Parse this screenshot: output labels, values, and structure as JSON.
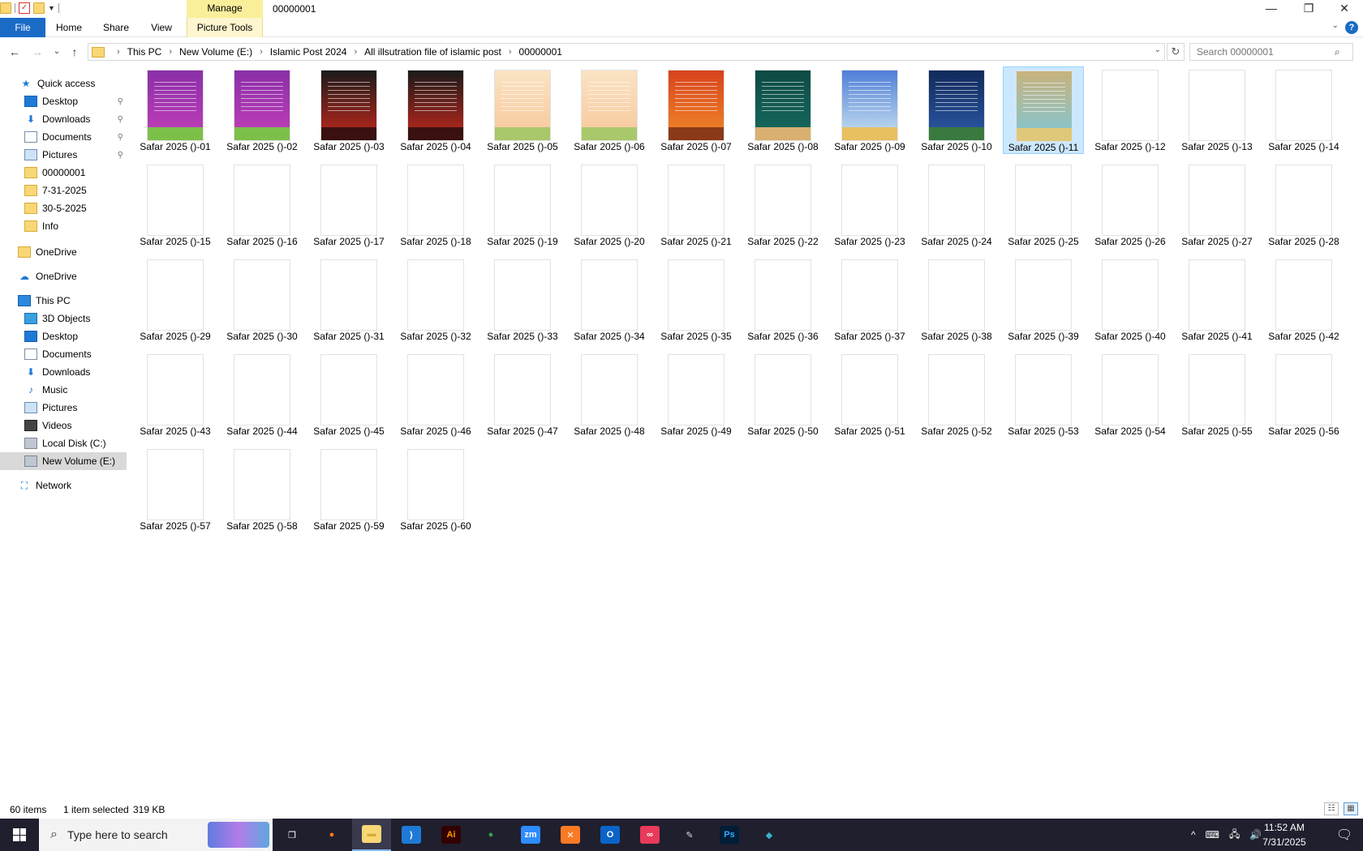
{
  "window": {
    "title": "00000001",
    "manage_label": "Manage",
    "minimize": "—",
    "restore": "❐",
    "close": "✕"
  },
  "ribbon": {
    "tabs": [
      "File",
      "Home",
      "Share",
      "View"
    ],
    "tools_tab": "Picture Tools",
    "collapse": "⌄",
    "help": "?"
  },
  "nav": {
    "back": "←",
    "forward": "→",
    "recent": "⌄",
    "up": "↑",
    "breadcrumbs": [
      "This PC",
      "New Volume (E:)",
      "Islamic Post 2024",
      "All illsutration file of islamic post",
      "00000001"
    ],
    "separator": "›",
    "dropdown": "⌄",
    "refresh": "↻",
    "search_placeholder": "Search 00000001",
    "search_icon": "⌕"
  },
  "sidebar": {
    "items": [
      {
        "label": "Quick access",
        "icon": "star-icon",
        "pinned": false
      },
      {
        "label": "Desktop",
        "icon": "desktop-icon",
        "pinned": true
      },
      {
        "label": "Downloads",
        "icon": "download-icon",
        "pinned": true
      },
      {
        "label": "Documents",
        "icon": "documents-icon",
        "pinned": true
      },
      {
        "label": "Pictures",
        "icon": "pictures-icon",
        "pinned": true
      },
      {
        "label": "00000001",
        "icon": "folder-icon",
        "pinned": false
      },
      {
        "label": "7-31-2025",
        "icon": "folder-icon",
        "pinned": false
      },
      {
        "label": "30-5-2025",
        "icon": "folder-icon",
        "pinned": false
      },
      {
        "label": "Info",
        "icon": "folder-icon",
        "pinned": false
      },
      {
        "label": "OneDrive",
        "icon": "folder-icon",
        "pinned": false
      },
      {
        "label": "OneDrive",
        "icon": "cloud-icon",
        "pinned": false
      },
      {
        "label": "This PC",
        "icon": "computer-icon",
        "pinned": false
      },
      {
        "label": "3D Objects",
        "icon": "3d-objects-icon",
        "pinned": false
      },
      {
        "label": "Desktop",
        "icon": "desktop-icon",
        "pinned": false
      },
      {
        "label": "Documents",
        "icon": "documents-icon",
        "pinned": false
      },
      {
        "label": "Downloads",
        "icon": "download-icon",
        "pinned": false
      },
      {
        "label": "Music",
        "icon": "music-icon",
        "pinned": false
      },
      {
        "label": "Pictures",
        "icon": "pictures-icon",
        "pinned": false
      },
      {
        "label": "Videos",
        "icon": "videos-icon",
        "pinned": false
      },
      {
        "label": "Local Disk (C:)",
        "icon": "disk-icon",
        "pinned": false
      },
      {
        "label": "New Volume (E:)",
        "icon": "drive-icon",
        "pinned": false,
        "selected": true
      },
      {
        "label": "Network",
        "icon": "network-icon",
        "pinned": false
      }
    ],
    "pin_glyph": "📌"
  },
  "files": {
    "selected_index": 10,
    "items": [
      {
        "name": "Safar 2025 ()-01",
        "thumb": "purple"
      },
      {
        "name": "Safar 2025 ()-02",
        "thumb": "purple"
      },
      {
        "name": "Safar 2025 ()-03",
        "thumb": "red-dark"
      },
      {
        "name": "Safar 2025 ()-04",
        "thumb": "red-dark"
      },
      {
        "name": "Safar 2025 ()-05",
        "thumb": "peach"
      },
      {
        "name": "Safar 2025 ()-06",
        "thumb": "peach"
      },
      {
        "name": "Safar 2025 ()-07",
        "thumb": "orange"
      },
      {
        "name": "Safar 2025 ()-08",
        "thumb": "teal"
      },
      {
        "name": "Safar 2025 ()-09",
        "thumb": "sky"
      },
      {
        "name": "Safar 2025 ()-10",
        "thumb": "navy"
      },
      {
        "name": "Safar 2025 ()-11",
        "thumb": "beach"
      },
      {
        "name": "Safar 2025 ()-12",
        "thumb": "blank"
      },
      {
        "name": "Safar 2025 ()-13",
        "thumb": "blank"
      },
      {
        "name": "Safar 2025 ()-14",
        "thumb": "blank"
      },
      {
        "name": "Safar 2025 ()-15",
        "thumb": "blank"
      },
      {
        "name": "Safar 2025 ()-16",
        "thumb": "blank"
      },
      {
        "name": "Safar 2025 ()-17",
        "thumb": "blank"
      },
      {
        "name": "Safar 2025 ()-18",
        "thumb": "blank"
      },
      {
        "name": "Safar 2025 ()-19",
        "thumb": "blank"
      },
      {
        "name": "Safar 2025 ()-20",
        "thumb": "blank"
      },
      {
        "name": "Safar 2025 ()-21",
        "thumb": "blank"
      },
      {
        "name": "Safar 2025 ()-22",
        "thumb": "blank"
      },
      {
        "name": "Safar 2025 ()-23",
        "thumb": "blank"
      },
      {
        "name": "Safar 2025 ()-24",
        "thumb": "blank"
      },
      {
        "name": "Safar 2025 ()-25",
        "thumb": "blank"
      },
      {
        "name": "Safar 2025 ()-26",
        "thumb": "blank"
      },
      {
        "name": "Safar 2025 ()-27",
        "thumb": "blank"
      },
      {
        "name": "Safar 2025 ()-28",
        "thumb": "blank"
      },
      {
        "name": "Safar 2025 ()-29",
        "thumb": "blank"
      },
      {
        "name": "Safar 2025 ()-30",
        "thumb": "blank"
      },
      {
        "name": "Safar 2025 ()-31",
        "thumb": "blank"
      },
      {
        "name": "Safar 2025 ()-32",
        "thumb": "blank"
      },
      {
        "name": "Safar 2025 ()-33",
        "thumb": "blank"
      },
      {
        "name": "Safar 2025 ()-34",
        "thumb": "blank"
      },
      {
        "name": "Safar 2025 ()-35",
        "thumb": "blank"
      },
      {
        "name": "Safar 2025 ()-36",
        "thumb": "blank"
      },
      {
        "name": "Safar 2025 ()-37",
        "thumb": "blank"
      },
      {
        "name": "Safar 2025 ()-38",
        "thumb": "blank"
      },
      {
        "name": "Safar 2025 ()-39",
        "thumb": "blank"
      },
      {
        "name": "Safar 2025 ()-40",
        "thumb": "blank"
      },
      {
        "name": "Safar 2025 ()-41",
        "thumb": "blank"
      },
      {
        "name": "Safar 2025 ()-42",
        "thumb": "blank"
      },
      {
        "name": "Safar 2025 ()-43",
        "thumb": "blank"
      },
      {
        "name": "Safar 2025 ()-44",
        "thumb": "blank"
      },
      {
        "name": "Safar 2025 ()-45",
        "thumb": "blank"
      },
      {
        "name": "Safar 2025 ()-46",
        "thumb": "blank"
      },
      {
        "name": "Safar 2025 ()-47",
        "thumb": "blank"
      },
      {
        "name": "Safar 2025 ()-48",
        "thumb": "blank"
      },
      {
        "name": "Safar 2025 ()-49",
        "thumb": "blank"
      },
      {
        "name": "Safar 2025 ()-50",
        "thumb": "blank"
      },
      {
        "name": "Safar 2025 ()-51",
        "thumb": "blank"
      },
      {
        "name": "Safar 2025 ()-52",
        "thumb": "blank"
      },
      {
        "name": "Safar 2025 ()-53",
        "thumb": "blank"
      },
      {
        "name": "Safar 2025 ()-54",
        "thumb": "blank"
      },
      {
        "name": "Safar 2025 ()-55",
        "thumb": "blank"
      },
      {
        "name": "Safar 2025 ()-56",
        "thumb": "blank"
      },
      {
        "name": "Safar 2025 ()-57",
        "thumb": "blank"
      },
      {
        "name": "Safar 2025 ()-58",
        "thumb": "blank"
      },
      {
        "name": "Safar 2025 ()-59",
        "thumb": "blank"
      },
      {
        "name": "Safar 2025 ()-60",
        "thumb": "blank"
      }
    ]
  },
  "thumb_colors": {
    "purple": {
      "top": "#8a2fa8",
      "bottom": "#c23fb8",
      "ground": "#7cc04a"
    },
    "red-dark": {
      "top": "#1a1a1a",
      "bottom": "#c4281c",
      "ground": "#3a1010"
    },
    "peach": {
      "top": "#fbe3c4",
      "bottom": "#f7c79a",
      "ground": "#a8c86a"
    },
    "orange": {
      "top": "#d8421c",
      "bottom": "#f08a2a",
      "ground": "#8a3a18"
    },
    "teal": {
      "top": "#0e4a44",
      "bottom": "#176b60",
      "ground": "#d8b070"
    },
    "sky": {
      "top": "#4f7ed8",
      "bottom": "#cde6f0",
      "ground": "#e8c060"
    },
    "navy": {
      "top": "#112a5a",
      "bottom": "#2c5aa8",
      "ground": "#3a7a40"
    },
    "beach": {
      "top": "#c8b27c",
      "bottom": "#7ec8d8",
      "ground": "#e0c87a"
    },
    "blank": {
      "top": "#ffffff",
      "bottom": "#ffffff",
      "ground": "#ffffff"
    }
  },
  "status": {
    "count": "60 items",
    "selection": "1 item selected",
    "size": "319 KB",
    "details_view": "☷",
    "icons_view": "▦"
  },
  "taskbar": {
    "search_text": "Type here to search",
    "search_icon": "⌕",
    "apps": [
      {
        "name": "task-view",
        "label": "❐",
        "bg": "transparent",
        "fg": "#ffffff"
      },
      {
        "name": "firefox",
        "label": "●",
        "bg": "transparent",
        "fg": "#ff7a1a"
      },
      {
        "name": "file-explorer",
        "label": "▬",
        "bg": "#f8d775",
        "fg": "#d8ab3c",
        "active": true
      },
      {
        "name": "vscode",
        "label": "⟩",
        "bg": "#1e7ad6",
        "fg": "#ffffff"
      },
      {
        "name": "illustrator",
        "label": "Ai",
        "bg": "#330000",
        "fg": "#ff9a00"
      },
      {
        "name": "chrome",
        "label": "●",
        "bg": "transparent",
        "fg": "#2aa84a"
      },
      {
        "name": "zoom",
        "label": "zm",
        "bg": "#2d8cff",
        "fg": "#ffffff"
      },
      {
        "name": "xampp",
        "label": "✕",
        "bg": "#fb7a24",
        "fg": "#ffffff"
      },
      {
        "name": "outlook",
        "label": "O",
        "bg": "#0a64c8",
        "fg": "#ffffff"
      },
      {
        "name": "creative-cloud",
        "label": "∞",
        "bg": "#e83a5a",
        "fg": "#ffffff"
      },
      {
        "name": "pen-tool",
        "label": "✎",
        "bg": "transparent",
        "fg": "#dddddd"
      },
      {
        "name": "photoshop",
        "label": "Ps",
        "bg": "#001e36",
        "fg": "#31a8ff"
      },
      {
        "name": "app-diamond",
        "label": "◆",
        "bg": "transparent",
        "fg": "#3ab0c8"
      }
    ],
    "tray": [
      "^",
      "⌨",
      "🖧",
      "🔊"
    ],
    "time": "11:52 AM",
    "date": "7/31/2025",
    "notification_icon": "🗨"
  }
}
